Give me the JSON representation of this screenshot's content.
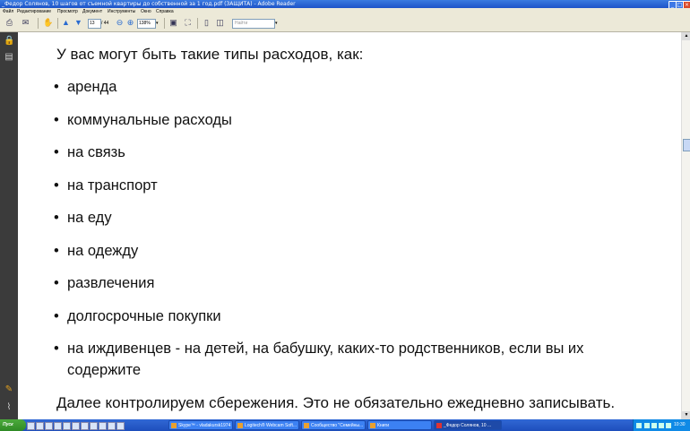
{
  "window": {
    "title": "_Федор Солянов, 10 шагов от съемной квартиры до  собственной за 1 год.pdf (ЗАЩИТА) - Adobe Reader",
    "controls": [
      "_",
      "□",
      "×"
    ]
  },
  "menu": [
    "Файл",
    "Редактирование",
    "Просмотр",
    "Документ",
    "Инструменты",
    "Окно",
    "Справка"
  ],
  "toolbar": {
    "page_current": "13",
    "page_total": "/ 44",
    "zoom": "138%",
    "find_placeholder": "Найти"
  },
  "document": {
    "intro": "У вас могут быть такие типы расходов, как:",
    "bullet": "•",
    "items": [
      "аренда",
      "коммунальные расходы",
      "на связь",
      "на транспорт",
      "на еду",
      "на одежду",
      "развлечения",
      "долгосрочные покупки",
      "на иждивенцев - на детей, на  бабушку, каких-то родственников, если вы их",
      "содержите"
    ],
    "outro": "Далее контролируем  сбережения. Это не обязательно ежедневно записывать."
  },
  "taskbar": {
    "start": "Пуск",
    "tasks": [
      "Skype™ - vladakursk1974",
      "Logitech® Webcam Soft...",
      "Сообщество \"Семейны...",
      "Книги",
      "_Федор Солянов, 10 ..."
    ],
    "clock": "10:30"
  },
  "colors": {
    "titlebar": "#1d54c8",
    "chrome": "#ece9d8",
    "nav_panel": "#3b3b3b",
    "taskbar": "#245edb",
    "start": "#3c9a2e"
  },
  "icons": {
    "nav": [
      "lock-icon",
      "pages-icon",
      "comment-icon",
      "attachment-icon"
    ]
  }
}
